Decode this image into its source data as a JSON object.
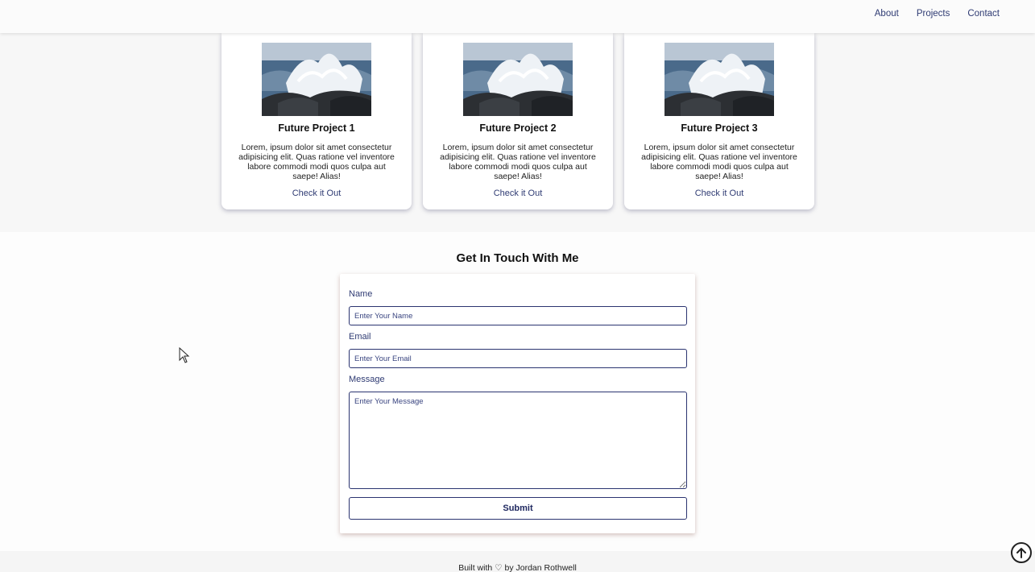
{
  "nav": {
    "links": [
      "About",
      "Projects",
      "Contact"
    ]
  },
  "projects": [
    {
      "title": "Future Project 1",
      "description": "Lorem, ipsum dolor sit amet consectetur adipisicing elit. Quas ratione vel inventore labore commodi modi quos culpa aut saepe! Alias!",
      "link": "Check it Out"
    },
    {
      "title": "Future Project 2",
      "description": "Lorem, ipsum dolor sit amet consectetur adipisicing elit. Quas ratione vel inventore labore commodi modi quos culpa aut saepe! Alias!",
      "link": "Check it Out"
    },
    {
      "title": "Future Project 3",
      "description": "Lorem, ipsum dolor sit amet consectetur adipisicing elit. Quas ratione vel inventore labore commodi modi quos culpa aut saepe! Alias!",
      "link": "Check it Out"
    }
  ],
  "contact": {
    "title": "Get In Touch With Me",
    "name_label": "Name",
    "name_placeholder": "Enter Your Name",
    "email_label": "Email",
    "email_placeholder": "Enter Your Email",
    "message_label": "Message",
    "message_placeholder": "Enter Your Message",
    "submit_label": "Submit"
  },
  "footer": {
    "text": "Built with ♡ by Jordan Rothwell"
  },
  "icons": {
    "back_to_top": "arrow-up-circle-icon",
    "project_image": "ocean-wave-photo"
  },
  "colors": {
    "accent": "#2f3b73",
    "border": "#2b3470"
  }
}
